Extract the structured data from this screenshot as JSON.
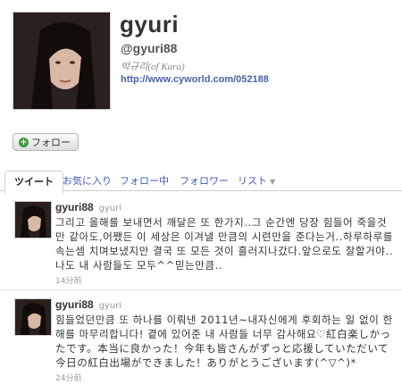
{
  "profile": {
    "screen_name": "gyuri",
    "handle": "@gyuri88",
    "bio": "박규리(of Kara)",
    "url": "http://www.cyworld.com/052188"
  },
  "follow_button": {
    "label": "フォロー",
    "icon": "plus-icon"
  },
  "tabs": [
    {
      "label": "ツイート",
      "active": true
    },
    {
      "label": "お気に入り"
    },
    {
      "label": "フォロー中"
    },
    {
      "label": "フォロワー"
    },
    {
      "label": "リスト"
    }
  ],
  "tweets": [
    {
      "name": "gyuri88",
      "username": "gyuri",
      "text": "그리고 올해를 보내면서 깨달은 또 한가지..그 순간엔 당장 힘들어 죽을것만 같아도,어쨌든 이 세상은 이겨낼 만큼의 시련만을 준다는거..하루하루를 속는셈 치며보냈지만 결국 또 모든 것이 흘러지나갔다.앞으로도 잘할거야..나도 내 사람들도 모두^^믿는만큼..",
      "time": "14分前"
    },
    {
      "name": "gyuri88",
      "username": "gyuri",
      "text": "힘들었던만큼 또 하나를 이뤄낸 2011년~내자신에게 후회하는 일 없이 한 해를 마무리합니다! 곁에 있어준 내 사람들 너무 감사해요♡紅白楽しかったです。本当に良かった！今年も皆さんがずっと応援していただいて今日の紅白出場ができました！ありがとうございます(^▽^)*",
      "time": "24分前"
    }
  ],
  "colors": {
    "link": "#3b5bb5",
    "url": "#4a62a8",
    "follow_plus": "#3c9a3c"
  }
}
